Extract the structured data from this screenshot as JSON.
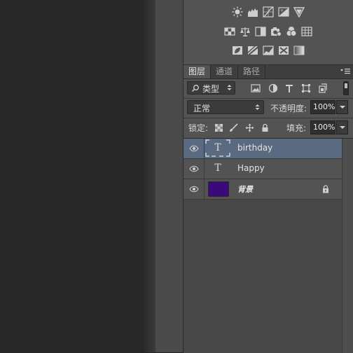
{
  "adjustments": {
    "icons_row1": [
      "brightness-icon",
      "levels-icon",
      "curves-icon",
      "exposure-icon",
      "vibrance-triangle-icon"
    ],
    "icons_row2": [
      "hue-saturation-icon",
      "color-balance-icon",
      "black-white-icon",
      "photo-filter-icon",
      "channel-mixer-icon",
      "color-lookup-icon"
    ],
    "icons_row3": [
      "invert-icon",
      "posterize-icon",
      "threshold-icon",
      "selective-color-icon",
      "gradient-map-icon"
    ]
  },
  "layers_panel": {
    "tabs": [
      {
        "label": "图层",
        "active": true
      },
      {
        "label": "通道",
        "active": false
      },
      {
        "label": "路径",
        "active": false
      }
    ],
    "filter": {
      "label": "类型"
    },
    "blend_mode": "正常",
    "opacity_label": "不透明度:",
    "opacity_value": "100%",
    "lock_label": "锁定:",
    "fill_label": "填充:",
    "fill_value": "100%",
    "layers": [
      {
        "name": "birthday",
        "type": "text",
        "selected": true
      },
      {
        "name": "Happy",
        "type": "text",
        "selected": false
      },
      {
        "name": "背景",
        "type": "background",
        "color": "#3c0a78",
        "locked": true
      }
    ]
  },
  "colors": {
    "selection": "#5a6a80",
    "panel": "#535353",
    "background_swatch": "#3c0a78"
  }
}
